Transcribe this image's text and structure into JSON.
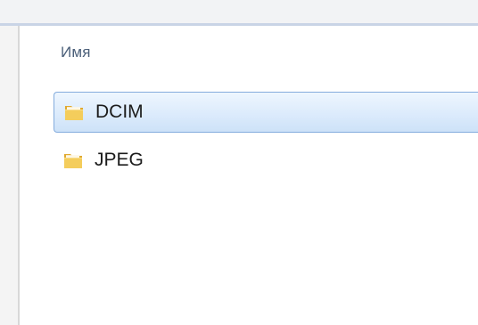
{
  "file_list": {
    "column_header": "Имя",
    "items": [
      {
        "name": "DCIM",
        "icon": "folder-icon",
        "selected": true
      },
      {
        "name": "JPEG",
        "icon": "folder-icon",
        "selected": false
      }
    ]
  },
  "colors": {
    "selection_border": "#84acdd",
    "selection_fill": "#dcebfc",
    "header_text": "#4c607a",
    "folder_yellow": "#f2c24a"
  }
}
